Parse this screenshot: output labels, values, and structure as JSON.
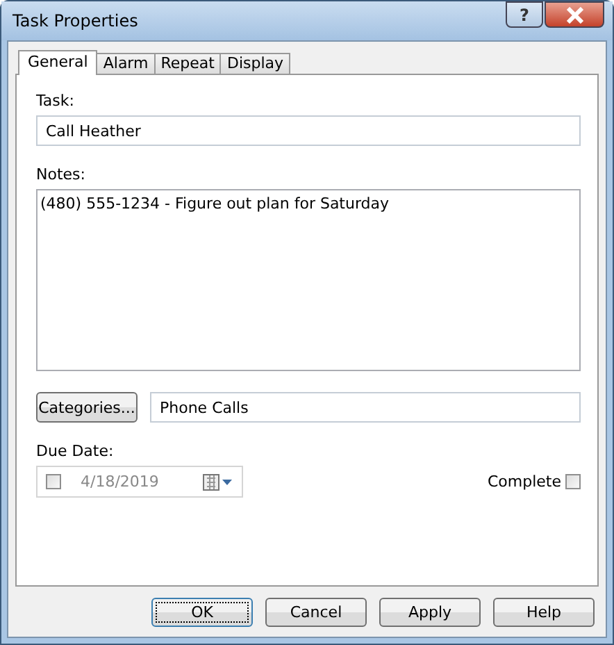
{
  "window": {
    "title": "Task Properties",
    "help_button": "?"
  },
  "tabs": [
    {
      "label": "General",
      "selected": true
    },
    {
      "label": "Alarm",
      "selected": false
    },
    {
      "label": "Repeat",
      "selected": false
    },
    {
      "label": "Display",
      "selected": false
    }
  ],
  "task": {
    "label": "Task:",
    "value": "Call Heather"
  },
  "notes": {
    "label": "Notes:",
    "value": "(480) 555-1234 - Figure out plan for Saturday"
  },
  "categories": {
    "button": "Categories...",
    "value": "Phone Calls"
  },
  "due_date": {
    "label": "Due Date:",
    "checked": false,
    "value": "4/18/2019"
  },
  "complete": {
    "label": "Complete",
    "checked": false
  },
  "buttons": [
    {
      "label": "OK",
      "default": true
    },
    {
      "label": "Cancel",
      "default": false
    },
    {
      "label": "Apply",
      "default": false
    },
    {
      "label": "Help",
      "default": false
    }
  ]
}
